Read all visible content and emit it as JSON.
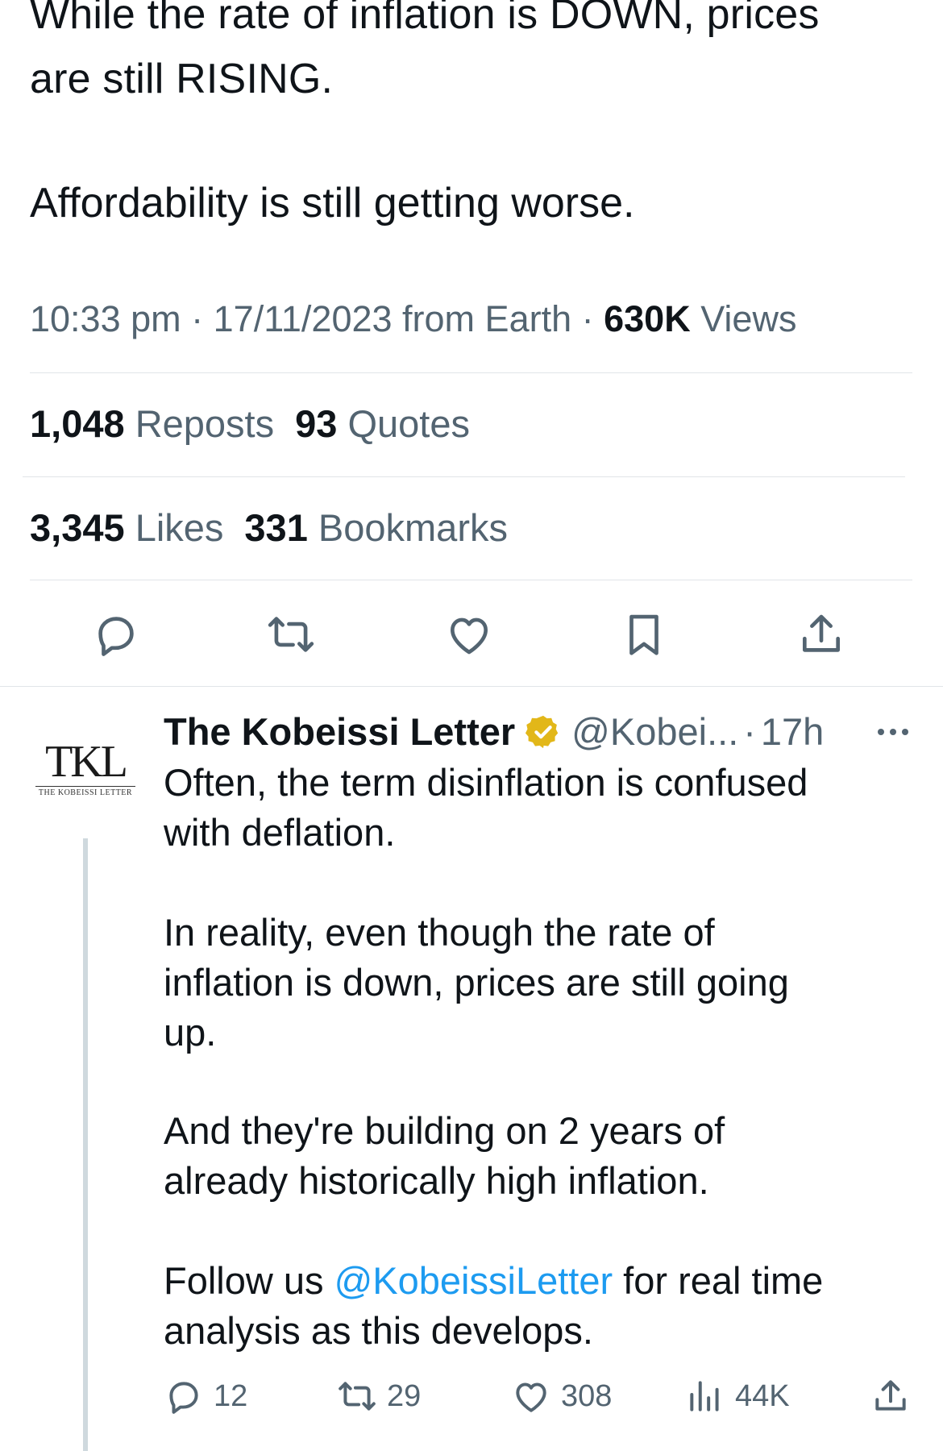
{
  "tweet": {
    "text_line1": "While the rate of inflation is DOWN, prices",
    "text_line2": "are still RISING.",
    "text_line3": "Affordability is still getting worse.",
    "time": "10:33 pm",
    "date": "17/11/2023",
    "source": "from Earth",
    "views_count": "630K",
    "views_label": "Views",
    "reposts_count": "1,048",
    "reposts_label": "Reposts",
    "quotes_count": "93",
    "quotes_label": "Quotes",
    "likes_count": "3,345",
    "likes_label": "Likes",
    "bookmarks_count": "331",
    "bookmarks_label": "Bookmarks"
  },
  "actions": {
    "icons": [
      "reply-icon",
      "repost-icon",
      "like-icon",
      "bookmark-icon",
      "share-icon"
    ]
  },
  "reply": {
    "avatar_mono": "TKL",
    "avatar_sub": "THE KOBEISSI LETTER",
    "name": "The Kobeissi Letter",
    "handle": "@Kobei...",
    "dot": "·",
    "age": "17h",
    "para1": "Often, the term disinflation is confused\nwith deflation.",
    "para2": "In reality, even though the rate of\ninflation is down, prices are still going\nup.",
    "para3": "And they're building on 2 years of\nalready historically high inflation.",
    "para4_pre": "Follow us ",
    "para4_mention": "@KobeissiLetter",
    "para4_post": " for real time\nanalysis as this develops.",
    "replies": "12",
    "reposts": "29",
    "likes": "308",
    "views": "44K"
  },
  "colors": {
    "text": "#0f1419",
    "secondary": "#536471",
    "link": "#1d9bf0",
    "divider": "#e1e5e8",
    "verified_gold": "#e2b719"
  }
}
